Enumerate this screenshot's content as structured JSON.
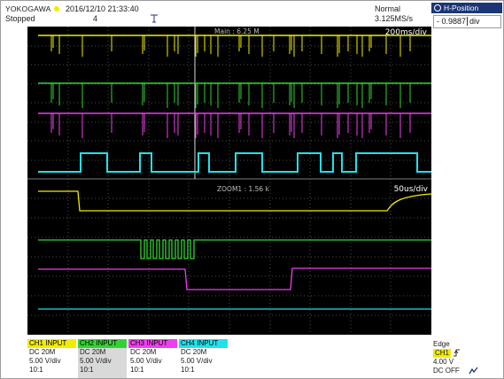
{
  "header": {
    "brand": "YOKOGAWA",
    "datetime": "2016/12/10 21:33:40",
    "status": "Stopped",
    "acq_count": "4",
    "acq_mode": "Normal",
    "sample_rate": "3.125MS/s",
    "trigger_pos_icon": "trigger-position-marker"
  },
  "hposition": {
    "title": "H-Position",
    "value": "- 0.9887",
    "unit": "div"
  },
  "screen": {
    "main_label": "Main : 6.25 M",
    "main_timebase": "200ms/div",
    "zoom_label": "ZOOM1 : 1.56 k",
    "zoom_timebase": "50us/div"
  },
  "channels": [
    {
      "header": "CH1 INPUT",
      "coupling": "DC 20M",
      "scale": "5.00 V/div",
      "probe": "10:1",
      "color": "#f2ec00"
    },
    {
      "header": "CH2 INPUT",
      "coupling": "DC 20M",
      "scale": "5.00 V/div",
      "probe": "10:1",
      "color": "#33d233"
    },
    {
      "header": "CH3 INPUT",
      "coupling": "DC 20M",
      "scale": "5.00 V/div",
      "probe": "10:1",
      "color": "#ee3fee"
    },
    {
      "header": "CH4 INPUT",
      "coupling": "DC 20M",
      "scale": "5.00 V/div",
      "probe": "10:1",
      "color": "#22e0ea"
    }
  ],
  "trigger": {
    "type": "Edge",
    "source": "CH1",
    "level": "4.00 V",
    "coupling": "DC OFF"
  },
  "colors": {
    "ch1": "#f2ec00",
    "ch2": "#33d233",
    "ch3": "#ee3fee",
    "ch4": "#22e0ea",
    "hpos_title_bg": "#1b3577"
  }
}
